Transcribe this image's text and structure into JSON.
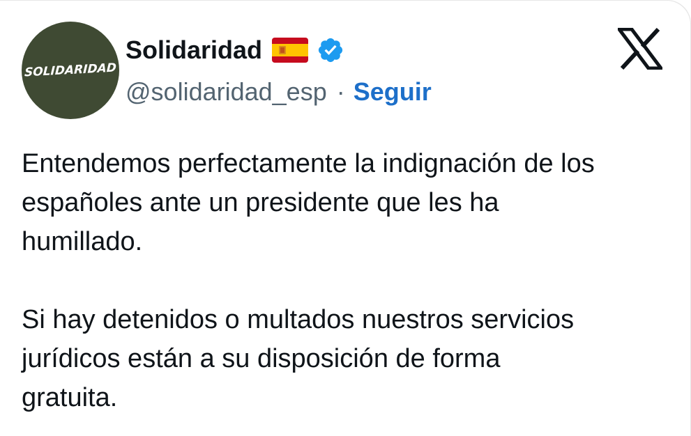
{
  "tweet": {
    "avatar_text": "SOLIDARIDAD",
    "display_name": "Solidaridad",
    "flag": "spain-flag-icon",
    "verified": "verified-badge-icon",
    "handle": "@solidaridad_esp",
    "separator": "·",
    "follow_label": "Seguir",
    "platform_logo": "x-logo-icon",
    "body": {
      "paragraph_1": "Entendemos perfectamente la indignación de los\nespañoles ante un presidente que les ha\nhumillado.",
      "paragraph_2": "Si hay detenidos o multados nuestros servicios\njurídicos están a su disposición de forma\ngratuita."
    }
  },
  "colors": {
    "verified_blue": "#1d9bf0",
    "follow_blue": "#1d6fc9",
    "handle_gray": "#536471",
    "avatar_green": "#3f4a33",
    "text": "#0f1419"
  }
}
